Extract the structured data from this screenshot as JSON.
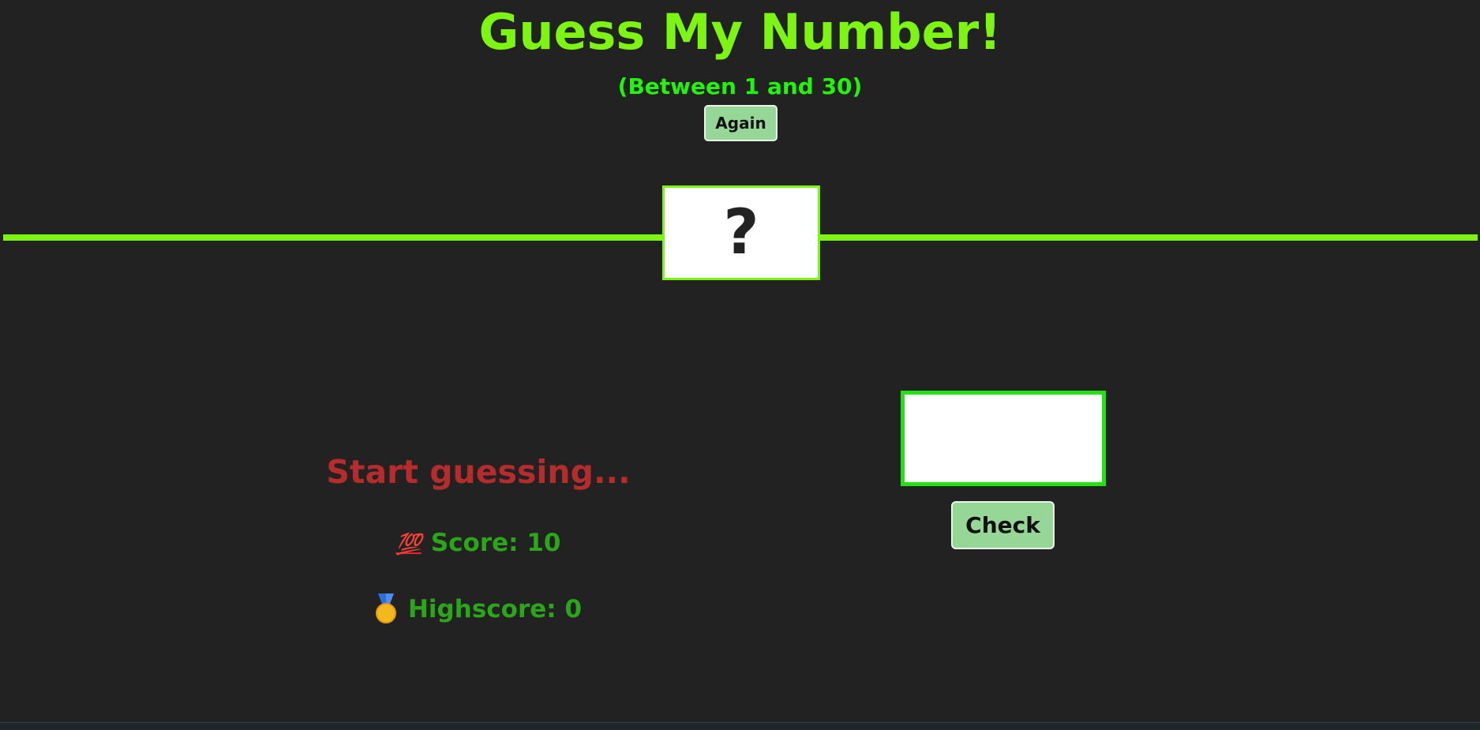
{
  "header": {
    "title": "Guess My Number!",
    "subtitle": "(Between 1 and 30)",
    "again_label": "Again"
  },
  "game": {
    "secret_display": "?",
    "message": "Start guessing...",
    "score_label": "Score: 10",
    "highscore_label": "Highscore: 0",
    "guess_value": "",
    "check_label": "Check"
  },
  "icons": {
    "score_icon": "hundred-points-emoji",
    "score_glyph": "💯",
    "highscore_icon": "medal-emoji"
  },
  "colors": {
    "background": "#222222",
    "title": "#7cf511",
    "subtitle": "#22f50a",
    "message": "#b62b2b",
    "stats": "#2aa618",
    "button": "#96d696",
    "input_border": "#22e30f"
  }
}
